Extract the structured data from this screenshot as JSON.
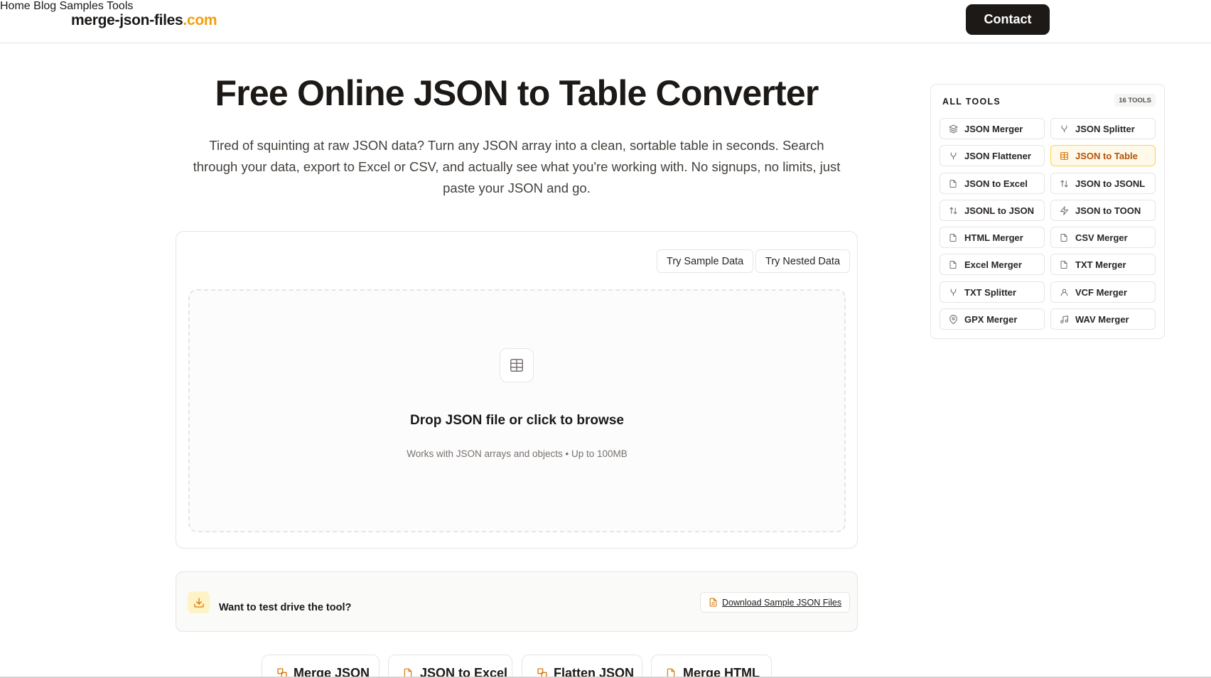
{
  "header": {
    "logo_main": "merge-json-files",
    "logo_tld": ".com",
    "nav": [
      "Home",
      "Blog",
      "Samples",
      "Tools"
    ],
    "contact_label": "Contact"
  },
  "hero": {
    "title": "Free Online JSON to Table Converter",
    "description": "Tired of squinting at raw JSON data? Turn any JSON array into a clean, sortable table in seconds. Search through your data, export to Excel or CSV, and actually see what you're working with. No signups, no limits, just paste your JSON and go."
  },
  "main_card": {
    "sample_button": "Try Sample Data",
    "nested_button": "Try Nested Data",
    "drop_icon": "table-icon",
    "drop_title": "Drop JSON file or click to browse",
    "drop_subtitle": "Works with JSON arrays and objects • Up to 100MB"
  },
  "test_drive": {
    "icon": "download-icon",
    "text": "Want to test drive the tool?",
    "download_label": "Download Sample JSON Files"
  },
  "related": [
    "Merge JSON",
    "JSON to Excel",
    "Flatten JSON",
    "Merge HTML"
  ],
  "sidebar": {
    "title": "ALL TOOLS",
    "count": "16 TOOLS",
    "tools": [
      {
        "label": "JSON Merger",
        "icon": "layers-icon"
      },
      {
        "label": "JSON Splitter",
        "icon": "split-icon"
      },
      {
        "label": "JSON Flattener",
        "icon": "split-icon"
      },
      {
        "label": "JSON to Table",
        "icon": "table-icon",
        "active": true
      },
      {
        "label": "JSON to Excel",
        "icon": "file-icon"
      },
      {
        "label": "JSON to JSONL",
        "icon": "arrows-updown-icon"
      },
      {
        "label": "JSONL to JSON",
        "icon": "arrows-updown-icon"
      },
      {
        "label": "JSON to TOON",
        "icon": "bolt-icon"
      },
      {
        "label": "HTML Merger",
        "icon": "file-icon"
      },
      {
        "label": "CSV Merger",
        "icon": "file-icon"
      },
      {
        "label": "Excel Merger",
        "icon": "file-icon"
      },
      {
        "label": "TXT Merger",
        "icon": "file-icon"
      },
      {
        "label": "TXT Splitter",
        "icon": "split-icon"
      },
      {
        "label": "VCF Merger",
        "icon": "user-icon"
      },
      {
        "label": "GPX Merger",
        "icon": "map-pin-icon"
      },
      {
        "label": "WAV Merger",
        "icon": "music-icon"
      }
    ]
  },
  "colors": {
    "accent": "#f59e0b",
    "dark": "#1c1917",
    "border": "#e7e5e4",
    "active_bg": "#fef9e8",
    "active_text": "#b45309"
  }
}
